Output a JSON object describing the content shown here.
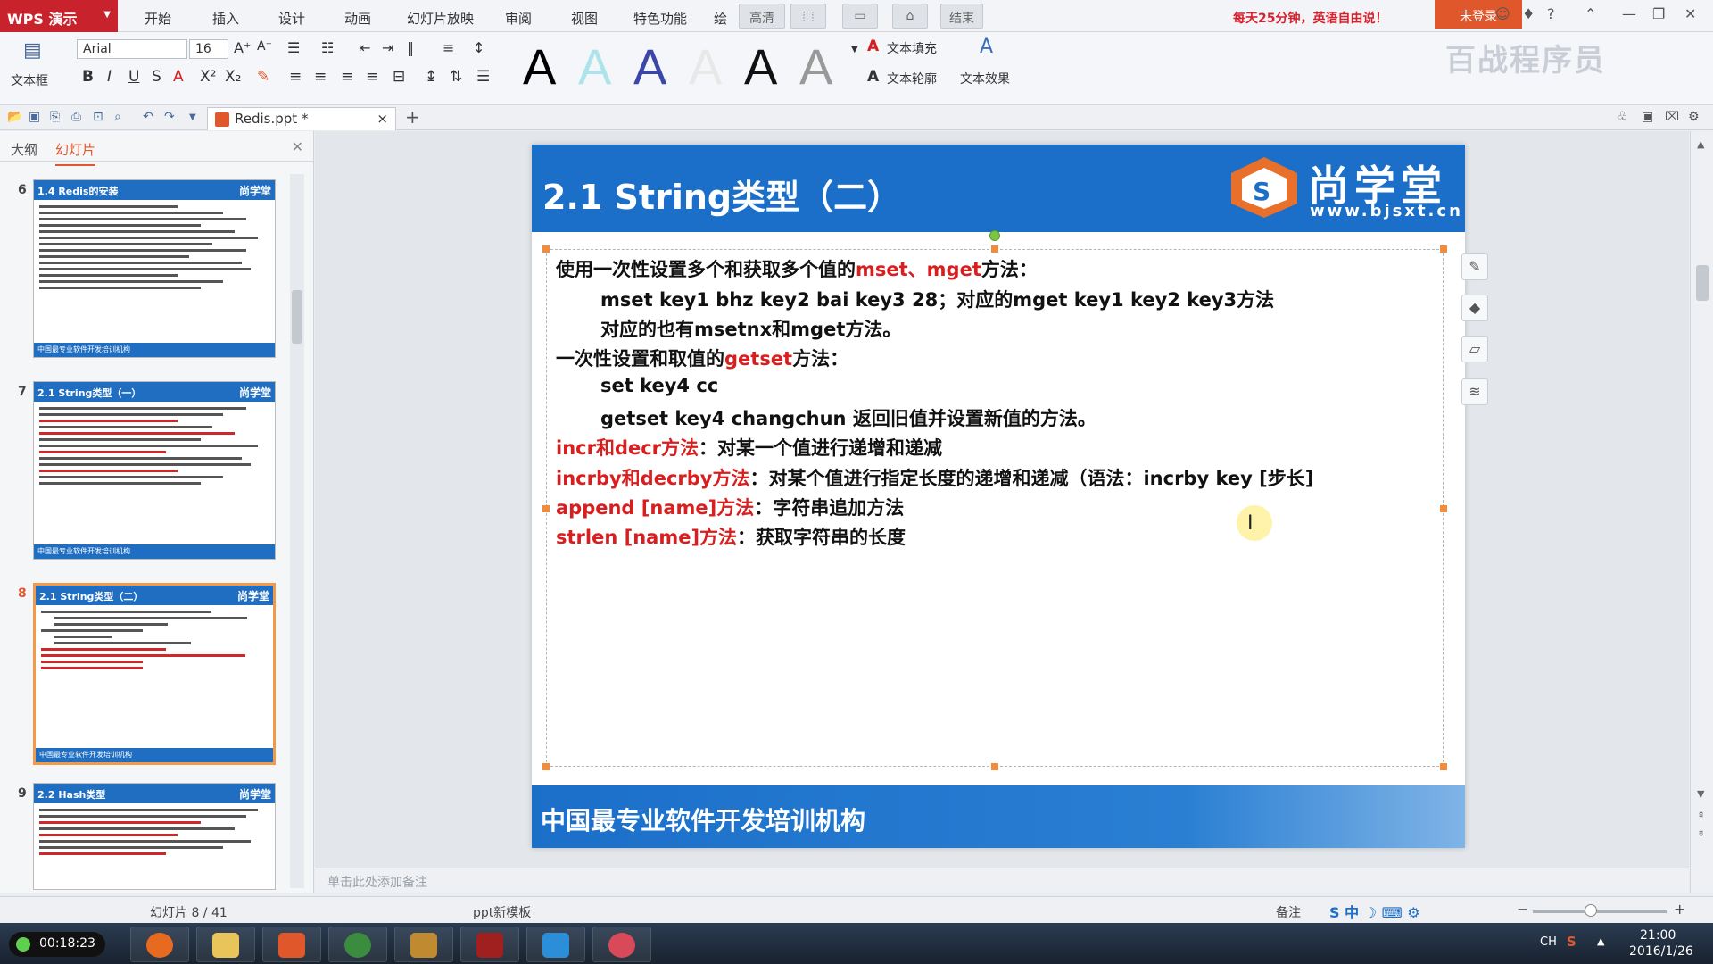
{
  "app": {
    "name": "WPS 演示"
  },
  "menu": {
    "items": [
      "开始",
      "插入",
      "设计",
      "动画",
      "幻灯片放映",
      "审阅",
      "视图",
      "特色功能",
      "绘"
    ],
    "segments": [
      "高清",
      "结束"
    ],
    "promo": "每天25分钟，英语自由说！",
    "login": "未登录"
  },
  "ribbon": {
    "textbox_label": "文本框",
    "font_name": "Arial",
    "font_size": "16",
    "text_fill": "文本填充",
    "text_outline": "文本轮廓",
    "text_effect": "文本效果"
  },
  "watermark": "百战程序员",
  "tab": {
    "doc_name": "Redis.ppt *"
  },
  "panel": {
    "tab_outline": "大纲",
    "tab_slides": "幻灯片",
    "thumbs": [
      {
        "num": "6",
        "title": "1.4 Redis的安装",
        "foot": "中国最专业软件开发培训机构"
      },
      {
        "num": "7",
        "title": "2.1 String类型（一）",
        "foot": "中国最专业软件开发培训机构"
      },
      {
        "num": "8",
        "title": "2.1 String类型（二）",
        "foot": "中国最专业软件开发培训机构"
      },
      {
        "num": "9",
        "title": "2.2 Hash类型",
        "foot": "中国最专业软件开发培训机构"
      }
    ],
    "logo": "尚学堂"
  },
  "slide": {
    "title": "2.1 String类型（二）",
    "logo_text": "尚学堂",
    "logo_url": "www.bjsxt.cn",
    "lines": [
      {
        "a": "使用一次性设置多个和获取多个值的",
        "r": "mset、mget",
        "b": "方法："
      },
      {
        "a": "mset key1 bhz key2 bai key3 28；对应的mget key1 key2 key3方法",
        "r": "",
        "b": ""
      },
      {
        "a": "对应的也有msetnx和mget方法。",
        "r": "",
        "b": ""
      },
      {
        "a": "一次性设置和取值的",
        "r": "getset",
        "b": "方法："
      },
      {
        "a": "set key4 cc",
        "r": "",
        "b": ""
      },
      {
        "a": "getset key4 changchun 返回旧值并设置新值的方法。",
        "r": "",
        "b": ""
      },
      {
        "a": "",
        "r": "incr和decr方法",
        "b": "：对某一个值进行递增和递减"
      },
      {
        "a": "",
        "r": "incrby和decrby方法",
        "b": "：对某个值进行指定长度的递增和递减（语法：incrby key [步长]"
      },
      {
        "a": "",
        "r": "append [name]方法",
        "b": "：字符串追加方法"
      },
      {
        "a": "",
        "r": "strlen [name]方法",
        "b": "：获取字符串的长度"
      }
    ],
    "footer": "中国最专业软件开发培训机构"
  },
  "notes": {
    "placeholder": "单击此处添加备注"
  },
  "status": {
    "slide_counter": "幻灯片 8 / 41",
    "template": "ppt新模板",
    "notes_btn": "备注"
  },
  "taskbar": {
    "recorder_time": "00:18:23",
    "lang": "CH",
    "time": "21:00",
    "date": "2016/1/26"
  },
  "colors": {
    "app_red": "#c8232c",
    "slide_blue": "#1b6fc9",
    "keyword_red": "#d81e1e",
    "login_orange": "#e0572c",
    "active_thumb": "#f29a4b"
  }
}
